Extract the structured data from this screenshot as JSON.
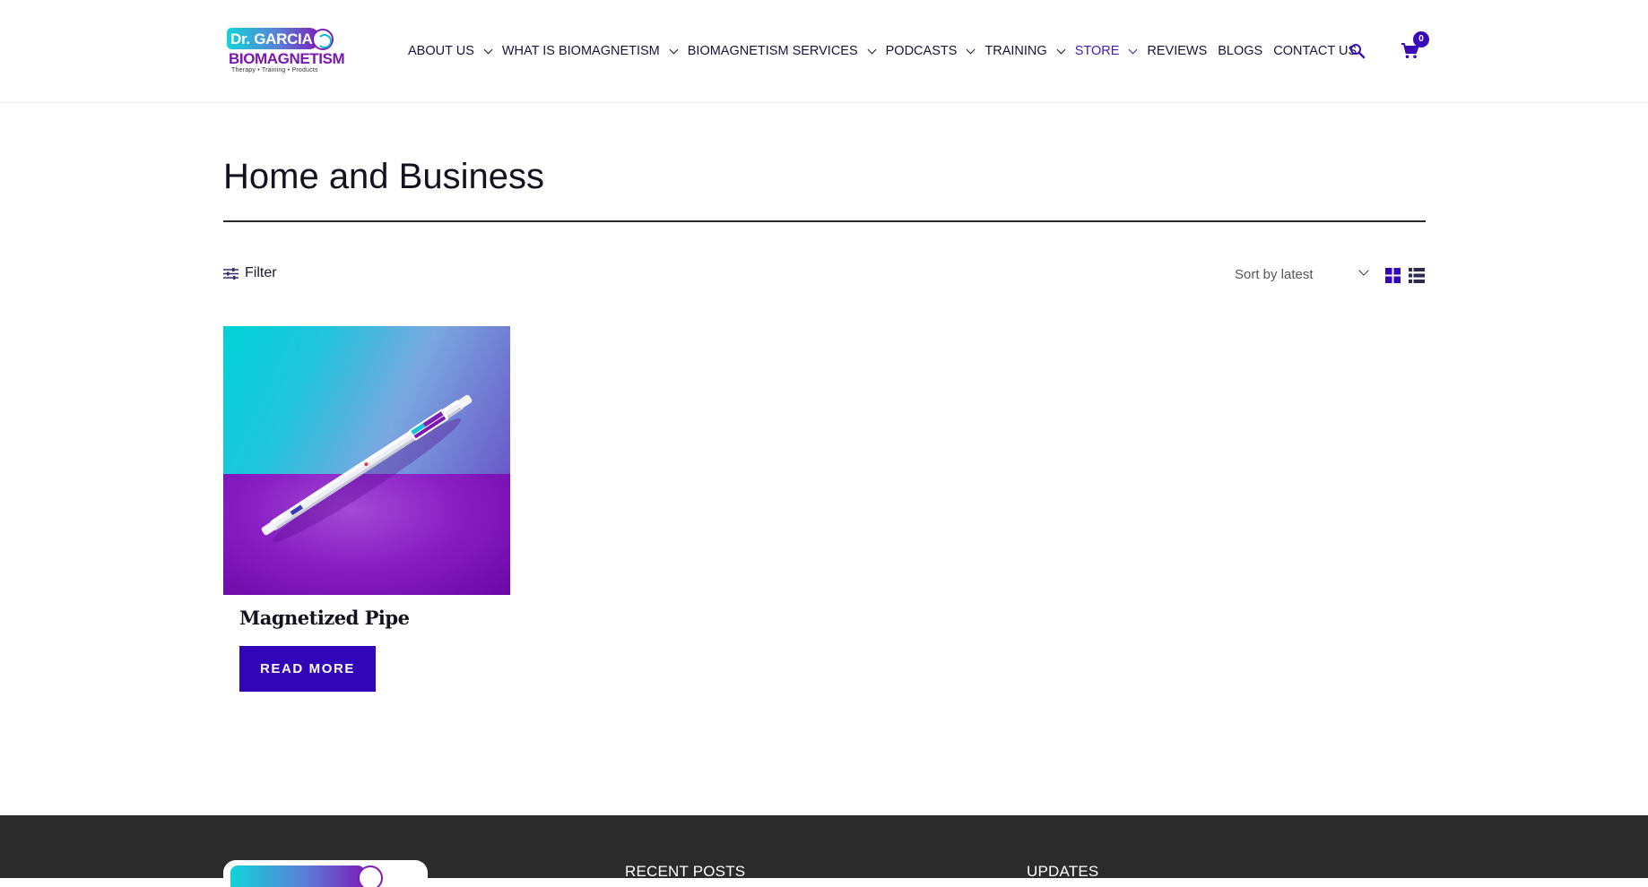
{
  "logo": {
    "top_text": "Dr. GARCIA",
    "main_text": "BIOMAGNETISM",
    "tagline": "Therapy • Training • Products"
  },
  "nav": {
    "items": [
      {
        "label": "ABOUT US",
        "dropdown": true,
        "active": false
      },
      {
        "label": "WHAT IS BIOMAGNETISM",
        "dropdown": true,
        "active": false
      },
      {
        "label": "BIOMAGNETISM SERVICES",
        "dropdown": true,
        "active": false
      },
      {
        "label": "PODCASTS",
        "dropdown": true,
        "active": false
      },
      {
        "label": "TRAINING",
        "dropdown": true,
        "active": false
      },
      {
        "label": "STORE",
        "dropdown": true,
        "active": true
      },
      {
        "label": "REVIEWS",
        "dropdown": false,
        "active": false
      },
      {
        "label": "BLOGS",
        "dropdown": false,
        "active": false
      },
      {
        "label": "CONTACT US",
        "dropdown": false,
        "active": false
      }
    ],
    "search_icon": "search-icon",
    "cart_icon": "cart-icon",
    "cart_count": "0"
  },
  "main": {
    "title": "Home and Business",
    "filter_label": "Filter",
    "sort_label": "Sort by latest",
    "view_grid_icon": "grid-view-icon",
    "view_list_icon": "list-view-icon"
  },
  "products": [
    {
      "name": "Magnetized Pipe",
      "button_label": "READ MORE"
    }
  ],
  "footer": {
    "recent_posts_heading": "RECENT POSTS",
    "updates_heading": "UPDATES"
  },
  "colors": {
    "accent": "#3305b8",
    "active_nav": "#4a16b8",
    "footer_bg": "#2b2b2b"
  }
}
